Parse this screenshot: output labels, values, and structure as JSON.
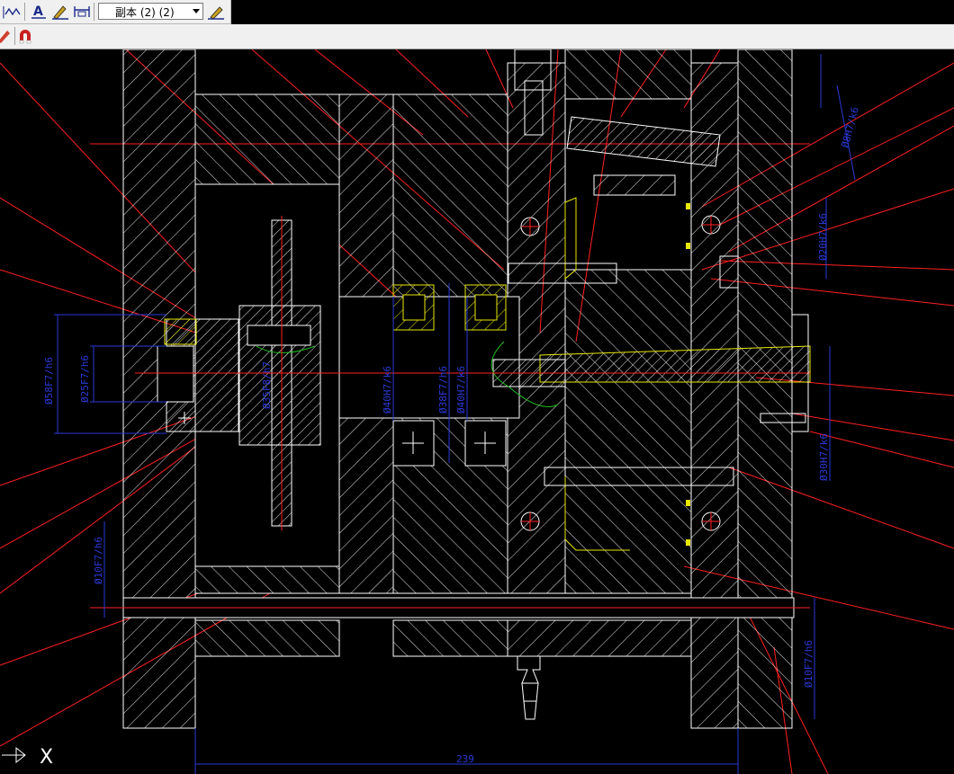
{
  "toolbar": {
    "dimstyle_value": "副本 (2) (2)",
    "icons": [
      "linear-dim-icon",
      "text-style-icon",
      "text-edit-icon",
      "dim-edit-icon",
      "dim-style-icon",
      "match-icon",
      "magnet-icon"
    ]
  },
  "drawing": {
    "dimensions": {
      "width_bottom": "239",
      "d58_left": "Ø58F7/h6",
      "d25_left": "Ø25F7/h6",
      "d35_hub": "Ø35F8/h7",
      "d40_a": "Ø40H7/k6",
      "d38": "Ø38F7/h6",
      "d40_b": "Ø40H7/k6",
      "d10_left": "Ø10F7/h6",
      "d10_right": "Ø10F7/h6",
      "d20_right": "Ø20H7/k6",
      "d30_right": "Ø30H7/k6",
      "d8_right": "Ø8H7/k6"
    },
    "colors": {
      "outline": "#ffffff",
      "hatch": "#e6e6e6",
      "yellow": "#e8e800",
      "centerline": "#ff2020",
      "dimension": "#2a3ad8",
      "green": "#20c020"
    }
  },
  "ucs": {
    "x_label": "X"
  }
}
